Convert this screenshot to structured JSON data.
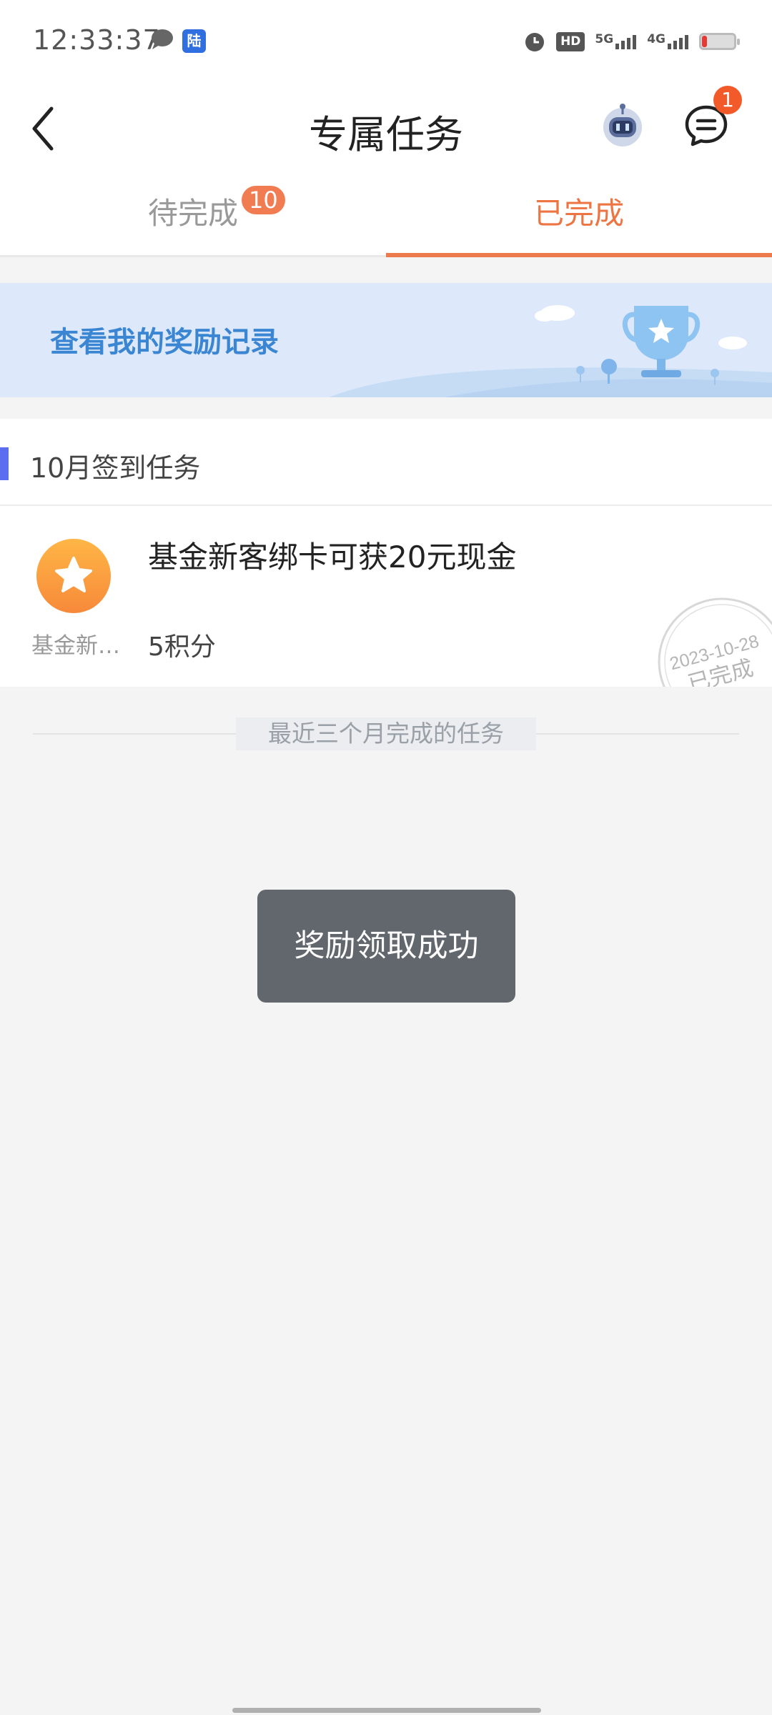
{
  "status_bar": {
    "time": "12:33:37",
    "app_icon_label": "陆",
    "hd_label": "HD",
    "net1_label": "5G",
    "net2_label": "4G",
    "icons": [
      "chat-bubble-icon",
      "lu-app-icon",
      "alarm-icon",
      "hd-icon",
      "signal-5g-icon",
      "signal-4g-icon",
      "battery-icon"
    ]
  },
  "header": {
    "title": "专属任务",
    "message_badge": "1",
    "icons": [
      "back-arrow-icon",
      "robot-assistant-icon",
      "message-bubble-icon"
    ]
  },
  "tabs": [
    {
      "label": "待完成",
      "badge": "10",
      "active": false
    },
    {
      "label": "已完成",
      "active": true
    }
  ],
  "banner": {
    "text": "查看我的奖励记录",
    "icon": "trophy-icon"
  },
  "section": {
    "title": "10月签到任务",
    "items": [
      {
        "icon": "star-icon",
        "caption": "基金新…",
        "title": "基金新客绑卡可获20元现金",
        "points": "5积分",
        "stamp_date": "2023-10-28",
        "stamp_status": "已完成"
      }
    ]
  },
  "divider_text": "最近三个月完成的任务",
  "toast": "奖励领取成功",
  "colors": {
    "accent_orange": "#ec7543",
    "banner_blue": "#3b86d2",
    "section_bar": "#5b6ef0",
    "badge_red": "#f35a2a"
  }
}
